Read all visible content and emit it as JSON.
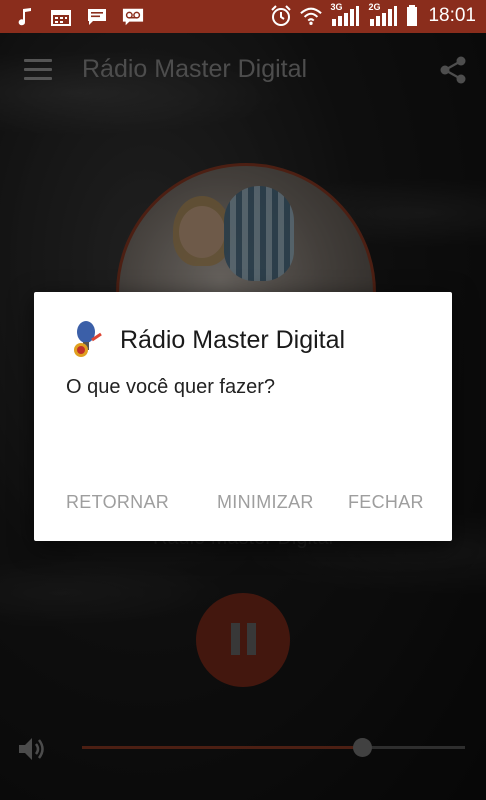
{
  "status_bar": {
    "time": "18:01",
    "network_1": "3G",
    "network_2": "2G",
    "icons": [
      "music-note-icon",
      "calendar-icon",
      "chat-icon",
      "voicemail-icon",
      "alarm-icon",
      "wifi-icon",
      "signal-icon",
      "battery-icon"
    ]
  },
  "toolbar": {
    "title": "Rádio Master Digital"
  },
  "player": {
    "station_name": "Rádio Master Digital",
    "volume_level": 0.73,
    "accent_color": "#8a3a24"
  },
  "dialog": {
    "title": "Rádio Master Digital",
    "message": "O que você quer fazer?",
    "buttons": {
      "return_label": "RETORNAR",
      "minimize_label": "MINIMIZAR",
      "close_label": "FECHAR"
    }
  }
}
